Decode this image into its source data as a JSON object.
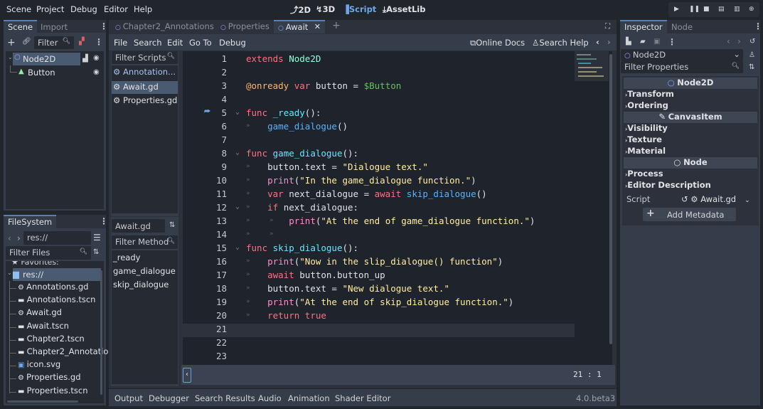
{
  "menubar": {
    "items": [
      "Scene",
      "Project",
      "Debug",
      "Editor",
      "Help"
    ],
    "workspaces": [
      {
        "label": "2D",
        "icon": "2d-icon"
      },
      {
        "label": "3D",
        "icon": "3d-icon"
      },
      {
        "label": "Script",
        "icon": "script-icon",
        "active": true
      },
      {
        "label": "AssetLib",
        "icon": "assetlib-icon"
      }
    ],
    "run_controls": [
      "play-icon",
      "pause-icon",
      "stop-icon",
      "play-scene-icon",
      "play-custom-scene-icon",
      "movie-maker-icon"
    ]
  },
  "scene_dock": {
    "tabs": [
      "Scene",
      "Import"
    ],
    "filter_placeholder": "Filter",
    "tree": [
      {
        "name": "Node2D",
        "icon": "node2d-icon",
        "selected": true,
        "has_script": true,
        "visible": true
      },
      {
        "name": "Button",
        "icon": "button-icon",
        "visible": true
      }
    ]
  },
  "filesystem_dock": {
    "tab": "FileSystem",
    "path": "res://",
    "filter_placeholder": "Filter Files",
    "favorites_label": "Favorites:",
    "root": "res://",
    "files": [
      {
        "name": "Annotations.gd",
        "icon": "gear-icon"
      },
      {
        "name": "Annotations.tscn",
        "icon": "scene-icon"
      },
      {
        "name": "Await.gd",
        "icon": "gear-icon"
      },
      {
        "name": "Await.tscn",
        "icon": "scene-icon"
      },
      {
        "name": "Chapter2.tscn",
        "icon": "scene-icon"
      },
      {
        "name": "Chapter2_Annotatio",
        "icon": "scene-icon"
      },
      {
        "name": "icon.svg",
        "icon": "image-icon"
      },
      {
        "name": "Properties.gd",
        "icon": "gear-icon"
      },
      {
        "name": "Properties.tscn",
        "icon": "scene-icon"
      }
    ]
  },
  "script_editor": {
    "scene_tabs": [
      {
        "label": "Chapter2_Annotations"
      },
      {
        "label": "Properties"
      },
      {
        "label": "Await",
        "active": true
      }
    ],
    "menu": [
      "File",
      "Search",
      "Edit",
      "Go To",
      "Debug"
    ],
    "online_docs": "Online Docs",
    "search_help": "Search Help",
    "filter_scripts_placeholder": "Filter Scripts",
    "scripts": [
      {
        "name": "Annotation...",
        "active": false
      },
      {
        "name": "Await.gd",
        "selected": true
      },
      {
        "name": "Properties.gd"
      }
    ],
    "current_script": "Await.gd",
    "filter_methods_placeholder": "Filter Method",
    "methods": [
      "_ready",
      "game_dialogue",
      "skip_dialogue"
    ],
    "cursor_line": "21",
    "cursor_col": "1",
    "code_lines": [
      {
        "n": "1",
        "html": "<span class='kw'>extends</span> <span class='cls'>Node2D</span>"
      },
      {
        "n": "2",
        "html": ""
      },
      {
        "n": "3",
        "html": "<span class='ann'>@onready</span> <span class='kw'>var</span> button = <span class='node'>$Button</span>"
      },
      {
        "n": "4",
        "html": ""
      },
      {
        "n": "5",
        "html": "<span class='kw'>func</span> <span class='fn'>_ready</span>():",
        "fold": true,
        "override": true
      },
      {
        "n": "6",
        "html": "    <span class='fn2'>game_dialogue</span>()",
        "tabs": 1
      },
      {
        "n": "7",
        "html": ""
      },
      {
        "n": "8",
        "html": "<span class='kw'>func</span> <span class='fn'>game_dialogue</span>():",
        "fold": true
      },
      {
        "n": "9",
        "html": "    button.text = <span class='str'>\"Dialogue text.\"</span>",
        "tabs": 1
      },
      {
        "n": "10",
        "html": "    <span class='kw2'>print</span>(<span class='str'>\"In the game_dialogue function.\"</span>)",
        "tabs": 1
      },
      {
        "n": "11",
        "html": "    <span class='kw'>var</span> next_dialogue = <span class='kw'>await</span> <span class='fn2'>skip_dialogue</span>()",
        "tabs": 1
      },
      {
        "n": "12",
        "html": "    <span class='kw'>if</span> next_dialogue:",
        "tabs": 1,
        "fold": true
      },
      {
        "n": "13",
        "html": "        <span class='kw2'>print</span>(<span class='str'>\"At the end of game_dialogue function.\"</span>)",
        "tabs": 2
      },
      {
        "n": "14",
        "html": "",
        "tabs": 2
      },
      {
        "n": "15",
        "html": "<span class='kw'>func</span> <span class='fn'>skip_dialogue</span>():",
        "fold": true
      },
      {
        "n": "16",
        "html": "    <span class='kw2'>print</span>(<span class='str'>\"Now in the slip_dialogue() function\"</span>)",
        "tabs": 1
      },
      {
        "n": "17",
        "html": "    <span class='kw'>await</span> button.button_up",
        "tabs": 1
      },
      {
        "n": "18",
        "html": "    button.text = <span class='str'>\"New dialogue text.\"</span>",
        "tabs": 1
      },
      {
        "n": "19",
        "html": "    <span class='kw2'>print</span>(<span class='str'>\"At the end of skip_dialogue function.\"</span>)",
        "tabs": 1
      },
      {
        "n": "20",
        "html": "    <span class='kw'>return</span> <span class='kw'>true</span>",
        "tabs": 1
      },
      {
        "n": "21",
        "html": "",
        "current": true
      },
      {
        "n": "22",
        "html": ""
      },
      {
        "n": "23",
        "html": ""
      }
    ]
  },
  "bottom_panel": {
    "tabs": [
      "Output",
      "Debugger",
      "Search Results",
      "Audio",
      "Animation",
      "Shader Editor"
    ],
    "version": "4.0.beta3"
  },
  "inspector": {
    "tabs": [
      "Inspector",
      "Node"
    ],
    "object": "Node2D",
    "filter_placeholder": "Filter Properties",
    "sections": [
      {
        "title": "Node2D",
        "icon": "node2d-icon",
        "categories": [
          "Transform",
          "Ordering"
        ]
      },
      {
        "title": "CanvasItem",
        "icon": "canvasitem-icon",
        "categories": [
          "Visibility",
          "Texture",
          "Material"
        ]
      },
      {
        "title": "Node",
        "icon": "node-icon",
        "categories": [
          "Process",
          "Editor Description"
        ]
      }
    ],
    "script_label": "Script",
    "script_value": "Await.gd",
    "add_metadata": "Add Metadata"
  }
}
